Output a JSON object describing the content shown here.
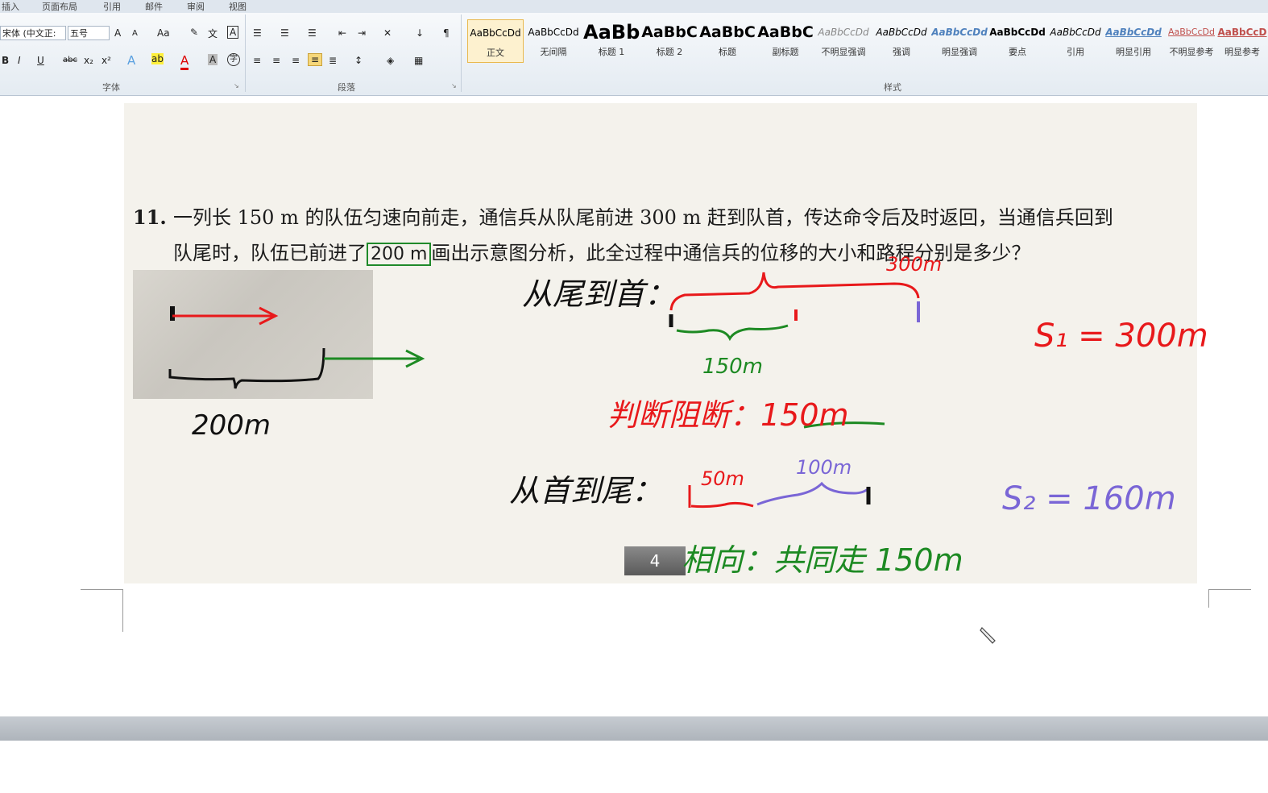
{
  "ribbon": {
    "tabs": [
      "插入",
      "页面布局",
      "引用",
      "邮件",
      "审阅",
      "视图"
    ],
    "font": {
      "font_name": "宋体 (中文正:",
      "font_size": "五号",
      "group_label": "字体",
      "buttons": [
        "A",
        "A",
        "Aa",
        "B",
        "I",
        "U",
        "abc",
        "x₂",
        "x²",
        "A"
      ]
    },
    "paragraph": {
      "group_label": "段落"
    },
    "styles": {
      "group_label": "样式",
      "items": [
        {
          "preview": "AaBbCcDd",
          "name": "正文"
        },
        {
          "preview": "AaBbCcDd",
          "name": "无间隔"
        },
        {
          "preview": "AaBb",
          "name": "标题 1"
        },
        {
          "preview": "AaBbC",
          "name": "标题 2"
        },
        {
          "preview": "AaBbC",
          "name": "标题"
        },
        {
          "preview": "AaBbC",
          "name": "副标题"
        },
        {
          "preview": "AaBbCcDd",
          "name": "不明显强调"
        },
        {
          "preview": "AaBbCcDd",
          "name": "强调"
        },
        {
          "preview": "AaBbCcDd",
          "name": "明显强调"
        },
        {
          "preview": "AaBbCcDd",
          "name": "要点"
        },
        {
          "preview": "AaBbCcDd",
          "name": "引用"
        },
        {
          "preview": "AaBbCcDd",
          "name": "明显引用"
        },
        {
          "preview": "AaBbCcDd",
          "name": "不明显参考"
        },
        {
          "preview": "AaBbCcD",
          "name": "明显参考"
        }
      ]
    }
  },
  "document": {
    "problem_number": "11.",
    "problem_line1": "一列长 150 m 的队伍匀速向前走，通信兵从队尾前进 300 m 赶到队首，传达命令后及时返回，当通信兵回到",
    "problem_line2_pre": "队尾时，队伍已前进了",
    "problem_boxed": "200 m",
    "problem_line2_post": "画出示意图分析，此全过程中通信兵的位移的大小和路程分别是多少？",
    "page_number": "4",
    "handwriting": {
      "left_len": "200m",
      "phase1_title": "从尾到首：",
      "phase1_top": "300m",
      "phase1_bottom": "150m",
      "catch_up": "判断阻断：150m",
      "s1": "S₁ = 300m",
      "phase2_title": "从首到尾：",
      "phase2_a": "50m",
      "phase2_b": "100m",
      "s2": "S₂ = 160m",
      "toward": "相向：共同走 150m"
    },
    "ink_colors": {
      "black": "#111111",
      "red": "#e8191b",
      "green": "#1d8a23",
      "purple": "#7a66d6"
    }
  }
}
